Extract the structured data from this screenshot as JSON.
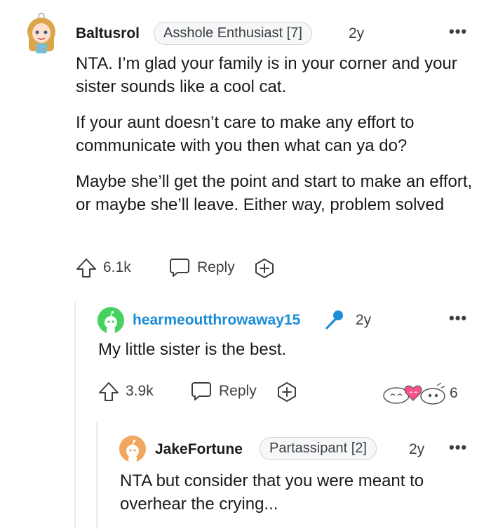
{
  "comments": [
    {
      "username": "Baltusrol",
      "flair": "Asshole Enthusiast [7]",
      "age": "2y",
      "paragraphs": [
        "NTA. I’m glad your family is in your corner and your sister sounds like a cool cat.",
        "If your aunt doesn’t care to make any effort to communicate with you then what can ya do?",
        "Maybe she’ll get the point and start to make an effort, or maybe she’ll leave. Either way, problem solved"
      ],
      "score": "6.1k",
      "reply_label": "Reply"
    },
    {
      "username": "hearmeoutthrowaway15",
      "username_color": "#1a8cd8",
      "age": "2y",
      "body": "My little sister is the best.",
      "score": "3.9k",
      "reply_label": "Reply",
      "awards_count": "6"
    },
    {
      "username": "JakeFortune",
      "flair": "Partassipant [2]",
      "age": "2y",
      "body": "NTA but consider that you were meant to overhear the crying..."
    }
  ],
  "colors": {
    "text": "#1a1a1b",
    "meta": "#3c3f42",
    "link_username": "#1a8cd8",
    "snoo_green": "#46d160",
    "award_pink": "#ff4f8b"
  },
  "icons": [
    "more-options-icon",
    "upvote-icon",
    "reply-bubble-icon",
    "award-plus-icon",
    "microphone-icon",
    "awards-icon"
  ]
}
